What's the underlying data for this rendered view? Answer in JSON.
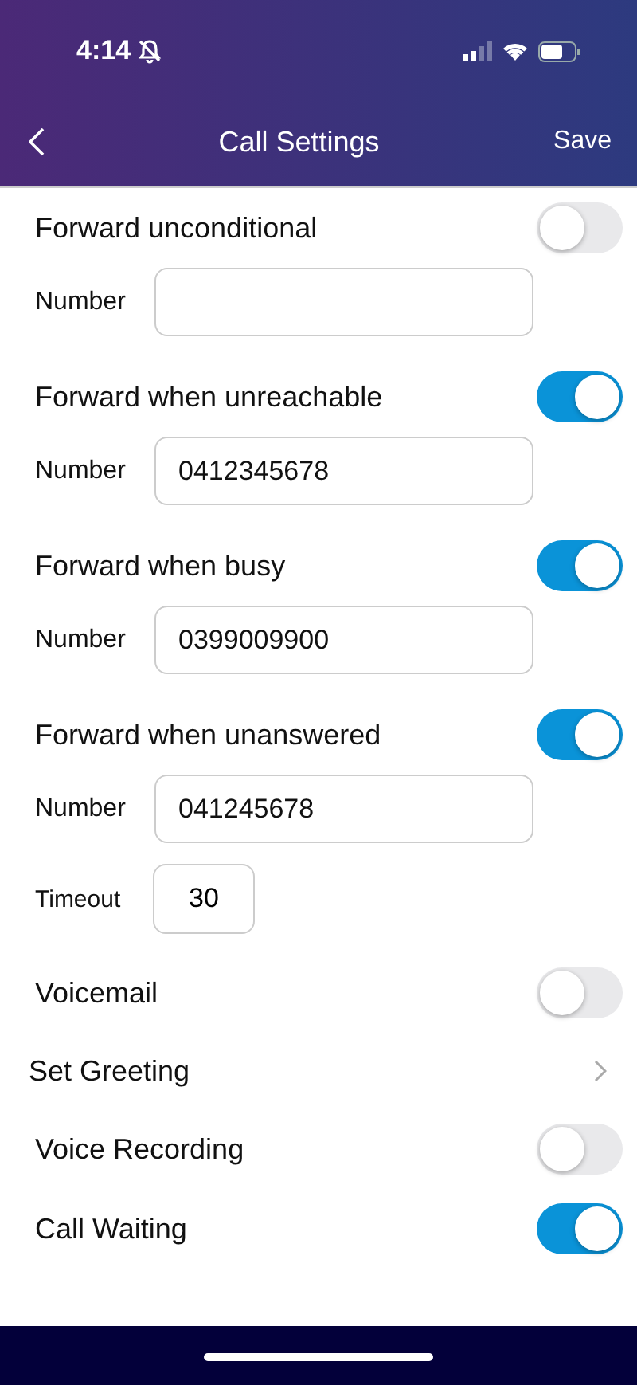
{
  "status_bar": {
    "time": "4:14"
  },
  "nav": {
    "title": "Call Settings",
    "action": "Save"
  },
  "items": [
    {
      "kind": "toggle",
      "label": "Forward unconditional",
      "on": false
    },
    {
      "kind": "number",
      "label": "Number",
      "value": ""
    },
    {
      "kind": "toggle",
      "label": "Forward when unreachable",
      "on": true
    },
    {
      "kind": "number",
      "label": "Number",
      "value": "0412345678"
    },
    {
      "kind": "toggle",
      "label": "Forward when busy",
      "on": true
    },
    {
      "kind": "number",
      "label": "Number",
      "value": "0399009900"
    },
    {
      "kind": "toggle",
      "label": "Forward when unanswered",
      "on": true
    },
    {
      "kind": "number",
      "label": "Number",
      "value": "041245678"
    },
    {
      "kind": "timeout",
      "label": "Timeout",
      "value": "30"
    },
    {
      "kind": "toggle",
      "label": "Voicemail",
      "on": false
    },
    {
      "kind": "link",
      "label": "Set Greeting"
    },
    {
      "kind": "toggle",
      "label": "Voice Recording",
      "on": false
    },
    {
      "kind": "toggle",
      "label": "Call Waiting",
      "on": true
    }
  ]
}
